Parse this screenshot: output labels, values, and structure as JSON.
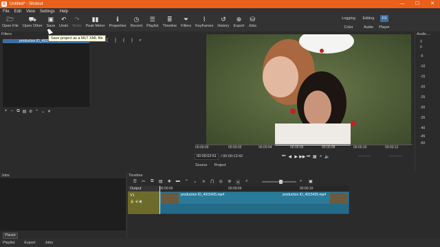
{
  "window": {
    "title": "Untitled* - Shotcut",
    "controls": [
      "—",
      "☐",
      "✕"
    ]
  },
  "menu": [
    "File",
    "Edit",
    "View",
    "Settings",
    "Help"
  ],
  "toolbar": {
    "buttons": [
      {
        "label": "Open File",
        "icon": "folder-open-icon"
      },
      {
        "label": "Open Other",
        "icon": "open-other-icon"
      },
      {
        "label": "Save",
        "icon": "save-icon"
      },
      {
        "label": "Undo",
        "icon": "undo-icon"
      },
      {
        "label": "Redo",
        "icon": "redo-icon"
      },
      {
        "label": "Peak Meter",
        "icon": "peak-meter-icon"
      },
      {
        "label": "Properties",
        "icon": "info-icon"
      },
      {
        "label": "Recent",
        "icon": "recent-icon"
      },
      {
        "label": "Playlist",
        "icon": "playlist-icon"
      },
      {
        "label": "Timeline",
        "icon": "timeline-icon"
      },
      {
        "label": "Filters",
        "icon": "filter-icon"
      },
      {
        "label": "Keyframes",
        "icon": "keyframes-icon"
      },
      {
        "label": "History",
        "icon": "history-icon"
      },
      {
        "label": "Export",
        "icon": "export-icon"
      },
      {
        "label": "Jobs",
        "icon": "jobs-icon"
      }
    ],
    "layouts": {
      "row1": [
        "Logging",
        "Editing",
        "FX"
      ],
      "row2": [
        "Color",
        "Audio",
        "Player"
      ]
    }
  },
  "tooltip": "Save project as a MLT XML file",
  "filters": {
    "title": "Filters",
    "selected_clip": "production ID_4915435.mp4",
    "side_title": "ames"
  },
  "player": {
    "ruler_ticks": [
      "00:00:00",
      "00:00:02",
      "00:00:04",
      "00:00:06",
      "00:00:08",
      "00:00:10",
      "00:00:12"
    ],
    "current_time": "00:00:02:51",
    "total_time": "/ 00:00:13:42",
    "in_point": "--:--:--:--",
    "duration": "--:--:--:--",
    "tabs": [
      "Source",
      "Project"
    ]
  },
  "audio": {
    "title": "Audio ...",
    "scale": [
      "3",
      "0",
      "-5",
      "-10",
      "-15",
      "-20",
      "-25",
      "-30",
      "-35",
      "-40",
      "-45",
      "-50"
    ]
  },
  "jobs": {
    "title": "Jobs",
    "pause_label": "Pause"
  },
  "timeline": {
    "title": "Timeline",
    "ruler_ticks": [
      "00:00:00",
      "00:00:05",
      "00:00:10"
    ],
    "output_label": "Output",
    "track_name": "V1",
    "clip_names": [
      "production ID_4915435.mp4",
      "production ID_4915435.mp4"
    ]
  },
  "bottom_tabs": [
    "Playlist",
    "Export",
    "Jobs"
  ]
}
